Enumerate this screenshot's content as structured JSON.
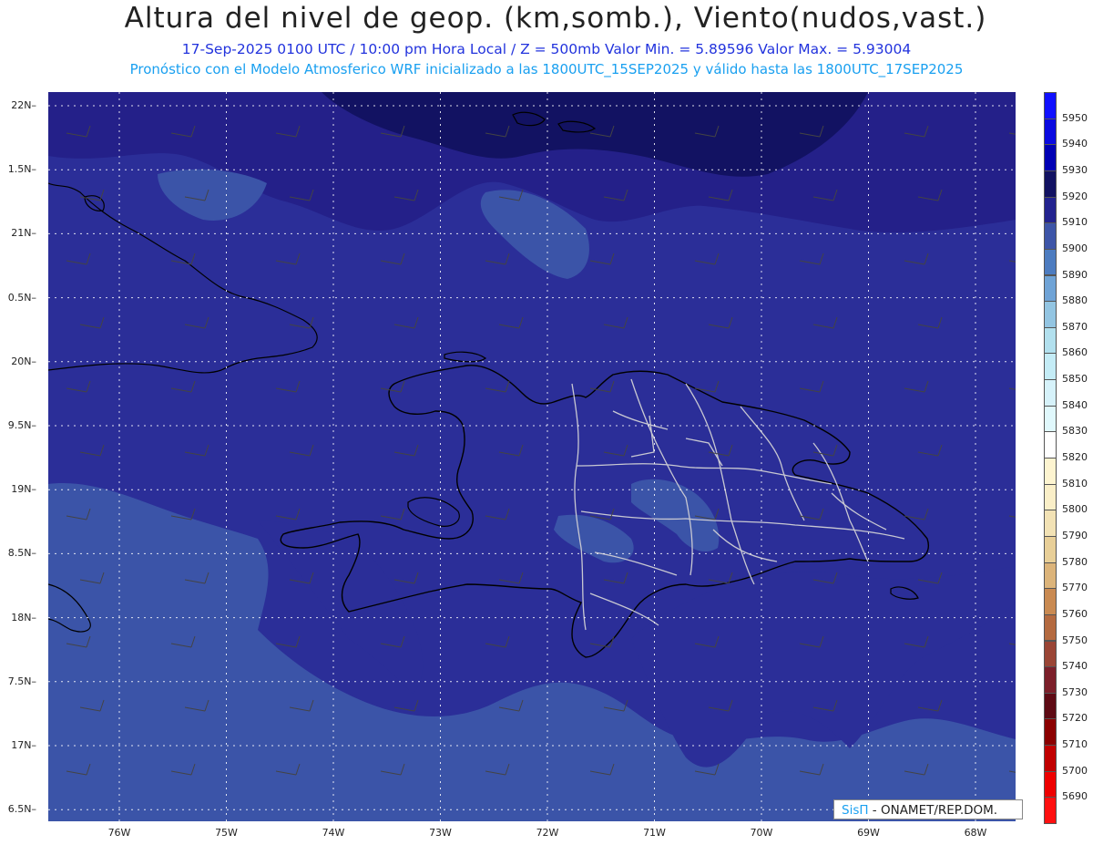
{
  "header": {
    "title": "Altura del nivel de geop. (km,somb.), Viento(nudos,vast.)",
    "subtitle": "17-Sep-2025  0100 UTC / 10:00 pm Hora Local / Z = 500mb    Valor Min. = 5.89596  Valor Max. = 5.93004",
    "model_line": "Pronóstico con el Modelo Atmosferico WRF inicializado a las 1800UTC_15SEP2025 y válido hasta las  1800UTC_17SEP2025"
  },
  "axes": {
    "lat_labels": [
      "22N",
      "1.5N",
      "21N",
      "0.5N",
      "20N",
      "9.5N",
      "19N",
      "8.5N",
      "18N",
      "7.5N",
      "17N",
      "6.5N"
    ],
    "lon_labels": [
      "76W",
      "75W",
      "74W",
      "73W",
      "72W",
      "71W",
      "70W",
      "69W",
      "68W"
    ]
  },
  "colorbar": {
    "levels": [
      "5950",
      "5940",
      "5930",
      "5920",
      "5910",
      "5900",
      "5890",
      "5880",
      "5870",
      "5860",
      "5850",
      "5840",
      "5830",
      "5820",
      "5810",
      "5800",
      "5790",
      "5780",
      "5770",
      "5760",
      "5750",
      "5740",
      "5730",
      "5720",
      "5710",
      "5700",
      "5690"
    ],
    "colors": [
      "#1010ff",
      "#0a0ae0",
      "#0000b4",
      "#121262",
      "#23238f",
      "#3d55a8",
      "#4d7cc0",
      "#6fa3d6",
      "#93c5e2",
      "#b2e0ee",
      "#c4ecf6",
      "#d6f2fa",
      "#e0f8fc",
      "#ffffff",
      "#fdf4d0",
      "#faefc8",
      "#f2e2b5",
      "#e8cf98",
      "#dcb47a",
      "#c98a52",
      "#b46a40",
      "#9a4535",
      "#7c1f2a",
      "#5e0a14",
      "#8b0000",
      "#c10000",
      "#ee0000",
      "#ff1010"
    ]
  },
  "map": {
    "colors": {
      "deep": "#242089",
      "mid": "#2b2e98",
      "light": "#3b54a8",
      "lighter": "#4468b4",
      "coast": "#000000",
      "provinces": "#c8c8d2",
      "grid": "#ffffff"
    }
  },
  "credit": {
    "brand": "SisΠ",
    "text": " -  ONAMET/REP.DOM."
  }
}
